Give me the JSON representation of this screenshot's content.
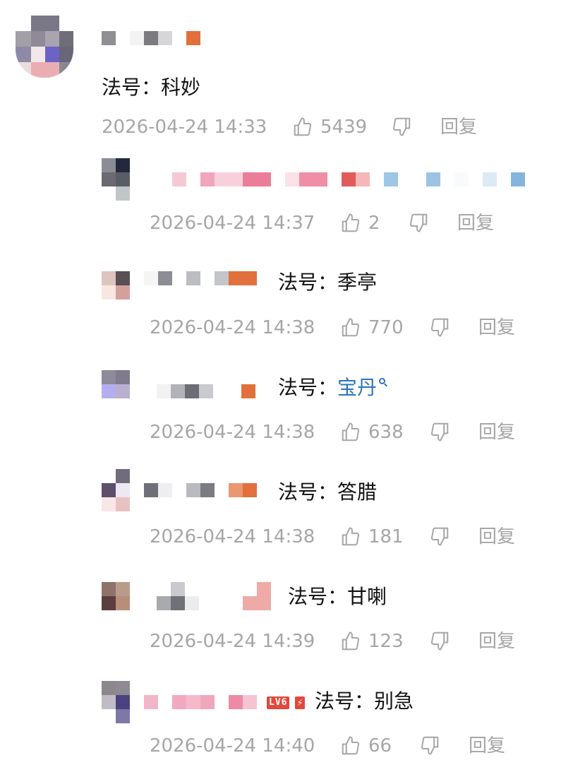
{
  "comments": [
    {
      "text": "法号：科妙",
      "time": "2026-04-24 14:33",
      "likes": "5439",
      "reply": "回复"
    },
    {
      "time": "2026-04-24 14:37",
      "likes": "2",
      "reply": "回复"
    },
    {
      "text": "法号：季亭",
      "time": "2026-04-24 14:38",
      "likes": "770",
      "reply": "回复"
    },
    {
      "text_prefix": "法号：",
      "text_link": "宝丹",
      "time": "2026-04-24 14:38",
      "likes": "638",
      "reply": "回复"
    },
    {
      "text": "法号：答腊",
      "time": "2026-04-24 14:38",
      "likes": "181",
      "reply": "回复"
    },
    {
      "text": "法号：甘喇",
      "time": "2026-04-24 14:39",
      "likes": "123",
      "reply": "回复"
    },
    {
      "badge": "LV6",
      "text": "法号：别急",
      "time": "2026-04-24 14:40",
      "likes": "66",
      "reply": "回复"
    }
  ],
  "colors": {
    "meta_gray": "#a6a6a6",
    "link_blue": "#2b76b9",
    "badge_red": "#e2483d",
    "text_dark": "#111111"
  },
  "icons": {
    "like": "thumbs-up-icon",
    "dislike": "thumbs-down-icon",
    "search": "search-icon"
  }
}
